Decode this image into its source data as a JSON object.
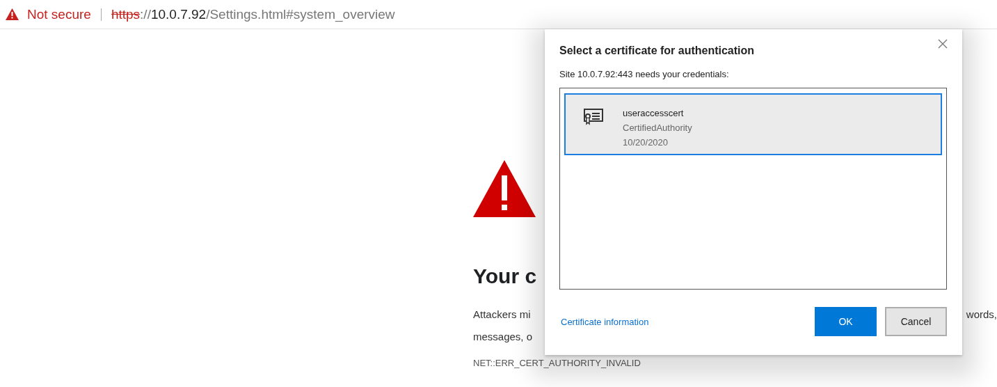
{
  "address_bar": {
    "security_label": "Not secure",
    "url": {
      "scheme": "https",
      "separator": "://",
      "host": "10.0.7.92",
      "path": "/Settings.html#system_overview"
    }
  },
  "page": {
    "heading": "Your c",
    "paragraph_lines": [
      {
        "left": "Attackers mi",
        "right": "words,"
      },
      {
        "left": "messages, o"
      }
    ],
    "error_code": "NET::ERR_CERT_AUTHORITY_INVALID"
  },
  "dialog": {
    "title": "Select a certificate for authentication",
    "message": "Site 10.0.7.92:443 needs your credentials:",
    "certificates": [
      {
        "name": "useraccesscert",
        "issuer": "CertifiedAuthority",
        "date": "10/20/2020",
        "selected": true
      }
    ],
    "link": "Certificate information",
    "buttons": [
      {
        "label": "OK",
        "kind": "primary"
      },
      {
        "label": "Cancel",
        "kind": "secondary"
      }
    ]
  }
}
